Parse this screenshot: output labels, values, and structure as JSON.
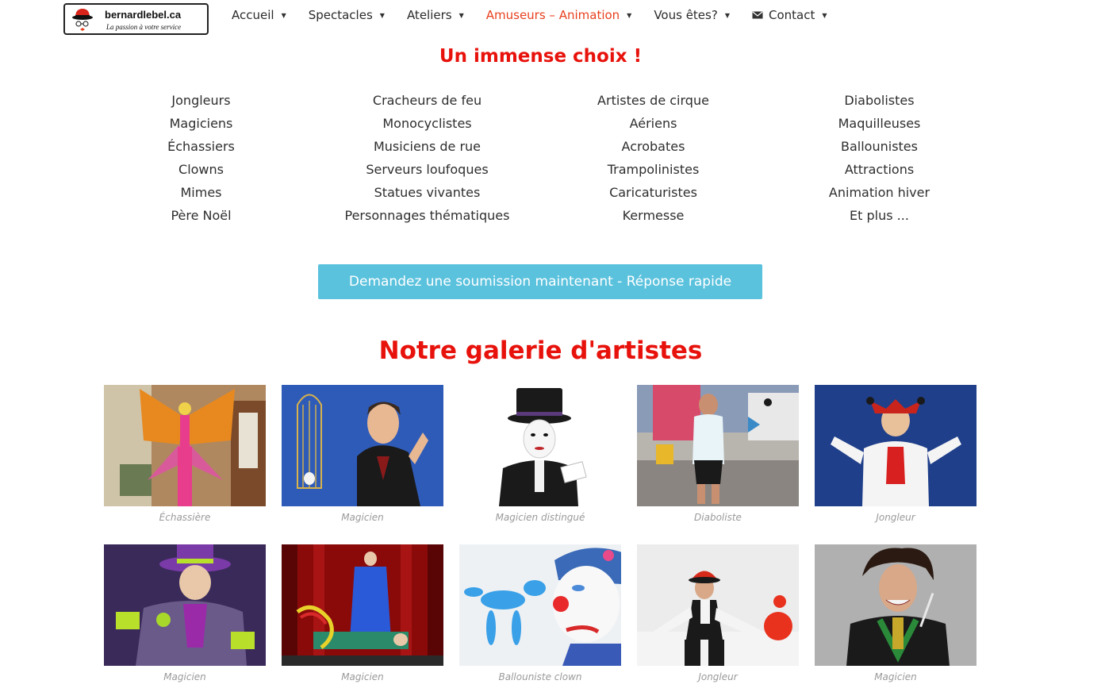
{
  "header": {
    "logo_brand": "bernardlebel.ca",
    "logo_tagline": "La passion à votre service",
    "nav": [
      {
        "label": "Accueil",
        "icon": null,
        "active": false
      },
      {
        "label": "Spectacles",
        "icon": null,
        "active": false
      },
      {
        "label": "Ateliers",
        "icon": null,
        "active": false
      },
      {
        "label": "Amuseurs – Animation",
        "icon": null,
        "active": true
      },
      {
        "label": "Vous êtes?",
        "icon": null,
        "active": false
      },
      {
        "label": "Contact",
        "icon": "envelope-icon",
        "active": false
      }
    ],
    "active_color": "#e8411f"
  },
  "choice_heading": "Un immense choix !",
  "categories": [
    [
      "Jongleurs",
      "Magiciens",
      "Échassiers",
      "Clowns",
      "Mimes",
      "Père Noël"
    ],
    [
      "Cracheurs de feu",
      "Monocyclistes",
      "Musiciens de rue",
      "Serveurs loufoques",
      "Statues vivantes",
      "Personnages thématiques"
    ],
    [
      "Artistes de cirque",
      "Aériens",
      "Acrobates",
      "Trampolinistes",
      "Caricaturistes",
      "Kermesse"
    ],
    [
      "Diabolistes",
      "Maquilleuses",
      "Ballounistes",
      "Attractions",
      "Animation hiver",
      "Et plus ..."
    ]
  ],
  "cta_label": "Demandez une soumission maintenant - Réponse rapide",
  "cta_color": "#5bc2dd",
  "heading_color": "#e8120c",
  "gallery_heading": "Notre galerie d'artistes",
  "gallery": [
    {
      "caption": "Échassière"
    },
    {
      "caption": "Magicien"
    },
    {
      "caption": "Magicien distingué"
    },
    {
      "caption": "Diaboliste"
    },
    {
      "caption": "Jongleur"
    },
    {
      "caption": "Magicien"
    },
    {
      "caption": "Magicien"
    },
    {
      "caption": "Ballouniste clown"
    },
    {
      "caption": "Jongleur"
    },
    {
      "caption": "Magicien"
    }
  ]
}
